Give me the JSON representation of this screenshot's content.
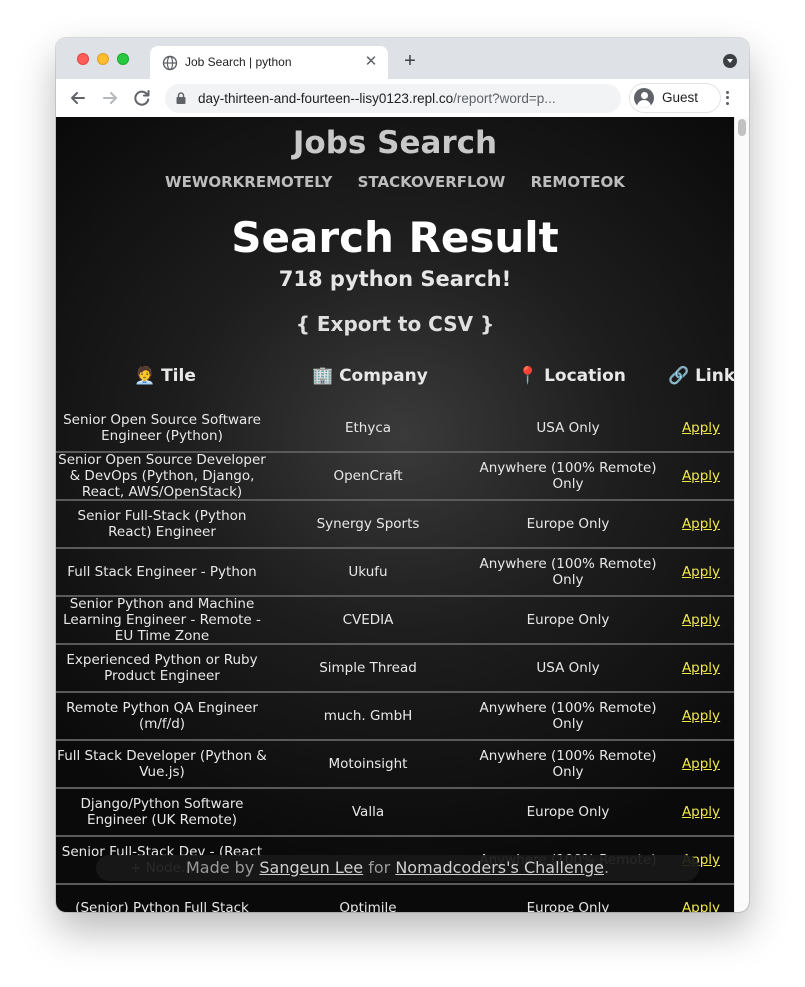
{
  "browser": {
    "tab_title": "Job Search | python",
    "url_host": "day-thirteen-and-fourteen--lisy0123.repl.co",
    "url_path": "/report?word=p...",
    "profile_name": "Guest"
  },
  "page": {
    "site_title": "Jobs Search",
    "nav": [
      "WEWORKREMOTELY",
      "STACKOVERFLOW",
      "REMOTEOK"
    ],
    "heading": "Search Result",
    "count_text": "718 python Search!",
    "export_text": "{ Export to CSV }",
    "table_headers": {
      "title": "🧑‍💼 Tile",
      "company": "🏢 Company",
      "location": "📍 Location",
      "link": "🔗 Link"
    },
    "rows": [
      {
        "title": "Senior Open Source Software Engineer (Python)",
        "company": "Ethyca",
        "location": "USA Only",
        "link": "Apply"
      },
      {
        "title": "Senior Open Source Developer & DevOps (Python, Django, React, AWS/OpenStack)",
        "company": "OpenCraft",
        "location": "Anywhere (100% Remote) Only",
        "link": "Apply"
      },
      {
        "title": "Senior Full-Stack (Python React) Engineer",
        "company": "Synergy Sports",
        "location": "Europe Only",
        "link": "Apply"
      },
      {
        "title": "Full Stack Engineer - Python",
        "company": "Ukufu",
        "location": "Anywhere (100% Remote) Only",
        "link": "Apply"
      },
      {
        "title": "Senior Python and Machine Learning Engineer - Remote - EU Time Zone",
        "company": "CVEDIA",
        "location": "Europe Only",
        "link": "Apply"
      },
      {
        "title": "Experienced Python or Ruby Product Engineer",
        "company": "Simple Thread",
        "location": "USA Only",
        "link": "Apply"
      },
      {
        "title": "Remote Python QA Engineer (m/f/d)",
        "company": "much. GmbH",
        "location": "Anywhere (100% Remote) Only",
        "link": "Apply"
      },
      {
        "title": "Full Stack Developer (Python & Vue.js)",
        "company": "Motoinsight",
        "location": "Anywhere (100% Remote) Only",
        "link": "Apply"
      },
      {
        "title": "Django/Python Software Engineer (UK Remote)",
        "company": "Valla",
        "location": "Europe Only",
        "link": "Apply"
      },
      {
        "title": "Senior Full-Stack Dev - (React + Node...",
        "company": "",
        "location": "Anywhere (100% Remote)",
        "link": "Apply"
      },
      {
        "title": "(Senior) Python Full Stack",
        "company": "Optimile",
        "location": "Europe Only",
        "link": "Apply"
      }
    ],
    "footer": {
      "made_by": "Made by ",
      "author": "Sangeun Lee",
      "for_text": " for ",
      "challenge": "Nomadcoders's Challenge",
      "period": "."
    }
  }
}
